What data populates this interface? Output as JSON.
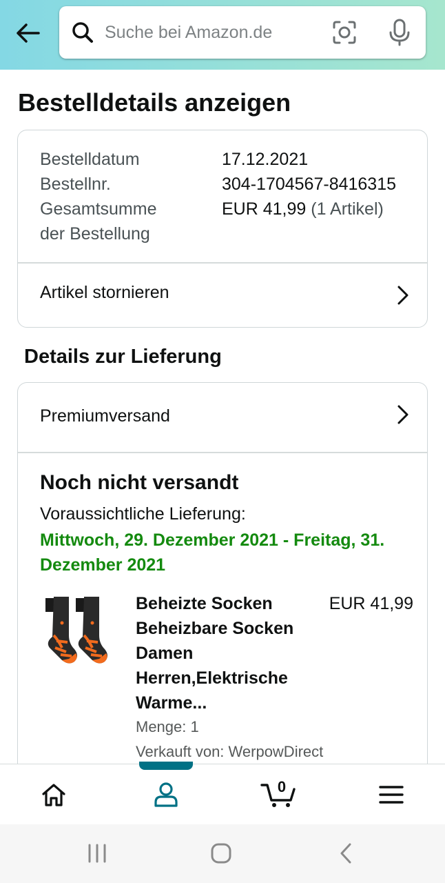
{
  "header": {
    "search_placeholder": "Suche bei Amazon.de"
  },
  "page": {
    "title": "Bestelldetails anzeigen"
  },
  "order": {
    "rows": [
      {
        "label": "Bestelldatum",
        "value": "17.12.2021",
        "extra": ""
      },
      {
        "label": "Bestellnr.",
        "value": "304-1704567-8416315",
        "extra": ""
      },
      {
        "label": "Gesamtsumme",
        "value": "EUR 41,99",
        "extra": "(1 Artikel)"
      },
      {
        "label": "der Bestellung",
        "value": "",
        "extra": ""
      }
    ],
    "cancel_label": "Artikel stornieren"
  },
  "delivery": {
    "section_title": "Details zur Lieferung",
    "shipping_method": "Premiumversand",
    "status": "Noch nicht versandt",
    "expected_label": "Voraussichtliche Lieferung:",
    "expected_dates": "Mittwoch, 29. Dezember 2021 - Freitag, 31. Dezember 2021",
    "product": {
      "title": "Beheizte Socken Beheizbare Socken Damen Herren,Elektrische Warme...",
      "price": "EUR 41,99",
      "quantity": "Menge: 1",
      "seller": "Verkauft von: WerpowDirect"
    }
  },
  "bottom_nav": {
    "cart_count": "0",
    "items": [
      "home-icon",
      "account-icon",
      "cart-icon",
      "menu-icon"
    ],
    "active": "account-icon"
  },
  "colors": {
    "header_gradient_start": "#84d8e4",
    "header_gradient_end": "#a6e6ce",
    "delivery_green": "#148a0f",
    "active_nav": "#007185"
  }
}
